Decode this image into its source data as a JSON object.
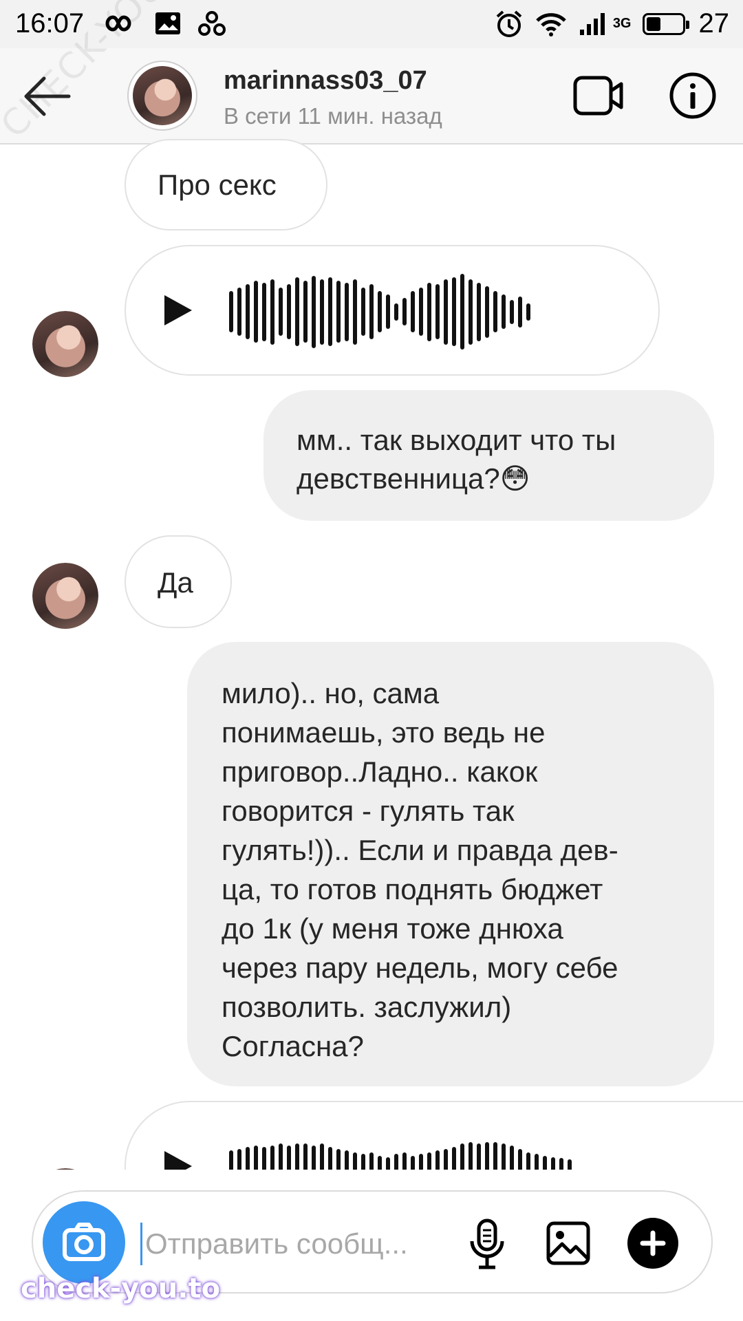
{
  "status_bar": {
    "time": "16:07",
    "network_label": "3G",
    "battery_level": "27"
  },
  "header": {
    "username": "marinnass03_07",
    "presence": "В сети 11 мин. назад"
  },
  "messages": {
    "m1_text": "Про секс",
    "m3_line1": "мм.. так выходит что ты",
    "m3_line2": "девственница?😳",
    "m4_text": "Да",
    "m5_lines": [
      "мило).. но, сама",
      "понимаешь, это ведь не",
      "приговор..Ладно.. какок",
      "говорится - гулять так",
      "гулять!)).. Если и правда дев-",
      "ца, то готов поднять бюджет",
      "до 1к (у меня тоже днюха",
      "через пару недель, могу себе",
      "позволить. заслужил)",
      "Согласна?"
    ]
  },
  "composer": {
    "placeholder": "Отправить сообщ..."
  },
  "watermark": {
    "bottom": "check-you.to",
    "diagonal": "CHECK-YOU.ME"
  },
  "icons": {
    "back": "arrow-left-icon",
    "video": "video-camera-icon",
    "info": "info-icon",
    "play": "play-icon",
    "camera": "camera-icon",
    "mic": "microphone-icon",
    "gallery": "image-icon",
    "plus": "plus-icon"
  },
  "colors": {
    "accent": "#3897f0",
    "outgoing_bubble": "#efefef",
    "secondary_text": "#8e8e8e"
  }
}
